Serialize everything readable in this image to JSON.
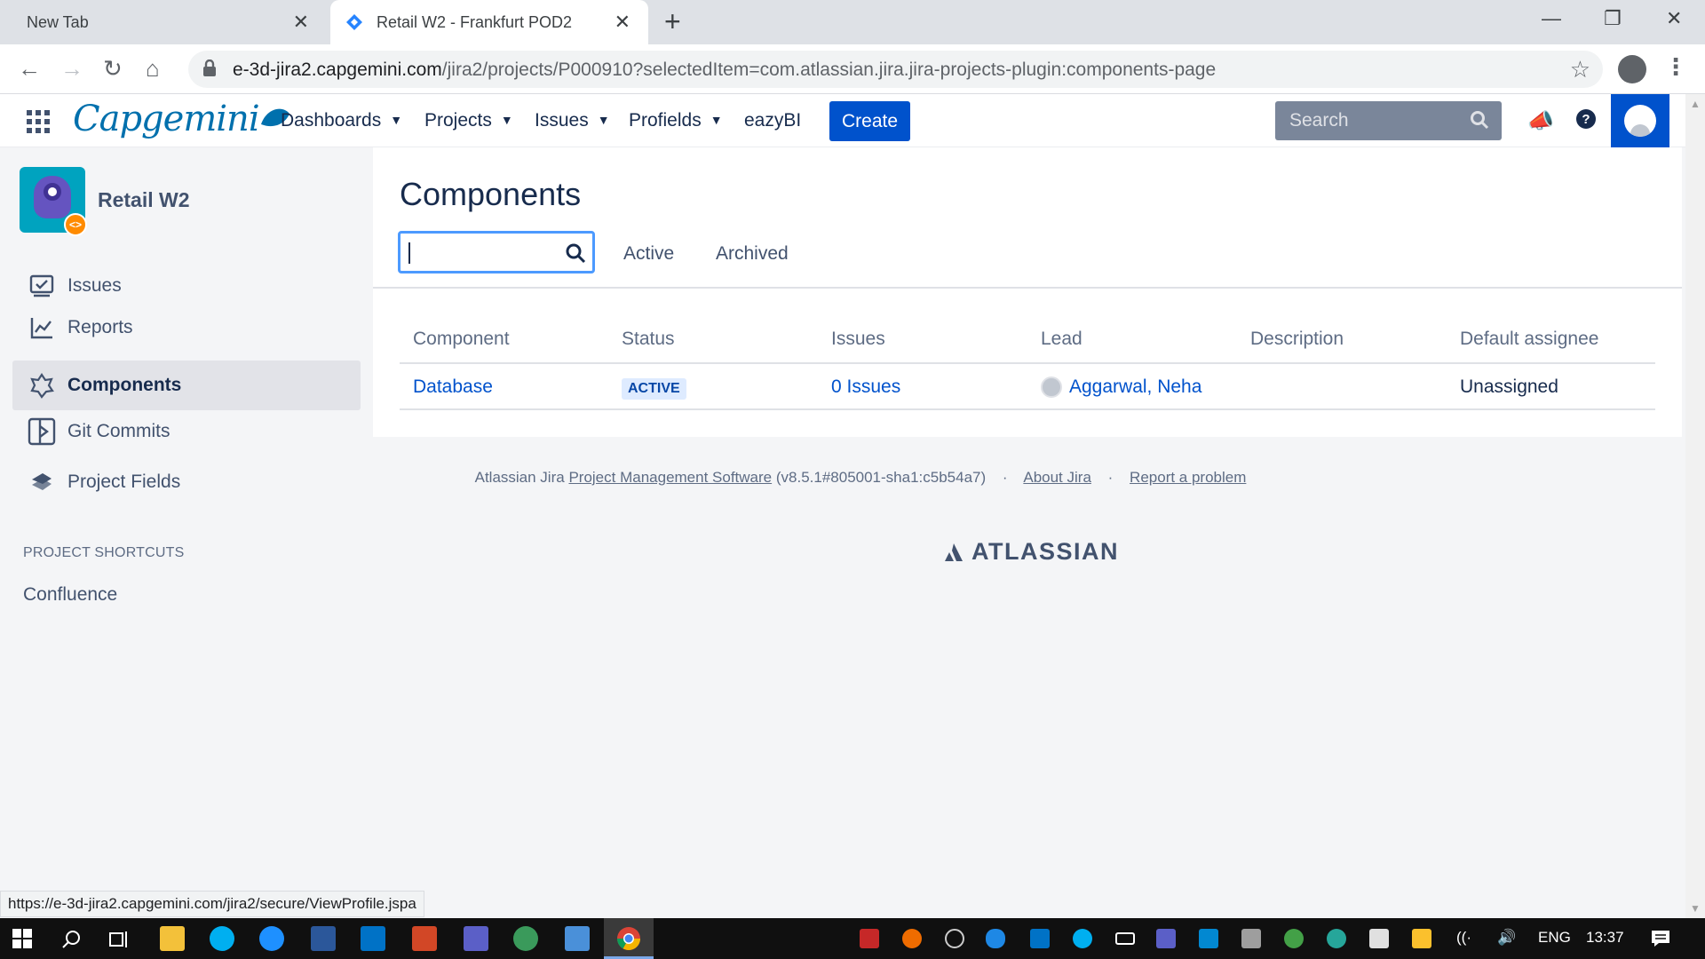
{
  "browser": {
    "tabs": [
      {
        "title": "New Tab",
        "active": false
      },
      {
        "title": "Retail W2 - Frankfurt POD2",
        "active": true
      }
    ],
    "url_host": "e-3d-jira2.capgemini.com",
    "url_path": "/jira2/projects/P000910?selectedItem=com.atlassian.jira.jira-projects-plugin:components-page",
    "status_url": "https://e-3d-jira2.capgemini.com/jira2/secure/ViewProfile.jspa"
  },
  "header": {
    "logo_text": "Capgemini",
    "menu": [
      {
        "label": "Dashboards",
        "has_dropdown": true
      },
      {
        "label": "Projects",
        "has_dropdown": true
      },
      {
        "label": "Issues",
        "has_dropdown": true
      },
      {
        "label": "Profields",
        "has_dropdown": true
      },
      {
        "label": "eazyBI",
        "has_dropdown": false
      }
    ],
    "create_label": "Create",
    "search_placeholder": "Search"
  },
  "sidebar": {
    "project_name": "Retail W2",
    "items": [
      {
        "label": "Issues",
        "icon": "issues-icon",
        "selected": false
      },
      {
        "label": "Reports",
        "icon": "reports-icon",
        "selected": false
      },
      {
        "label": "Components",
        "icon": "components-icon",
        "selected": true
      },
      {
        "label": "Git Commits",
        "icon": "git-commits-icon",
        "selected": false
      },
      {
        "label": "Project Fields",
        "icon": "project-fields-icon",
        "selected": false
      }
    ],
    "shortcuts_heading": "PROJECT SHORTCUTS",
    "shortcuts": [
      {
        "label": "Confluence"
      }
    ]
  },
  "main": {
    "title": "Components",
    "filter_value": "",
    "tabs": [
      {
        "label": "Active"
      },
      {
        "label": "Archived"
      }
    ],
    "table": {
      "columns": [
        "Component",
        "Status",
        "Issues",
        "Lead",
        "Description",
        "Default assignee"
      ],
      "rows": [
        {
          "component": "Database",
          "status": "ACTIVE",
          "issues": "0 Issues",
          "lead": "Aggarwal, Neha",
          "description": "",
          "default_assignee": "Unassigned"
        }
      ]
    }
  },
  "footer": {
    "prefix": "Atlassian Jira",
    "pm_link": "Project Management Software",
    "version": "(v8.5.1#805001-sha1:c5b54a7)",
    "separator": "·",
    "about_link": "About Jira",
    "report_link": "Report a problem",
    "atlassian_logo_text": "ATLASSIAN"
  },
  "taskbar": {
    "language": "ENG",
    "time": "13:37"
  },
  "colors": {
    "accent": "#0052cc",
    "capgemini_blue": "#0070ad",
    "active_lozenge_bg": "#deebff"
  }
}
